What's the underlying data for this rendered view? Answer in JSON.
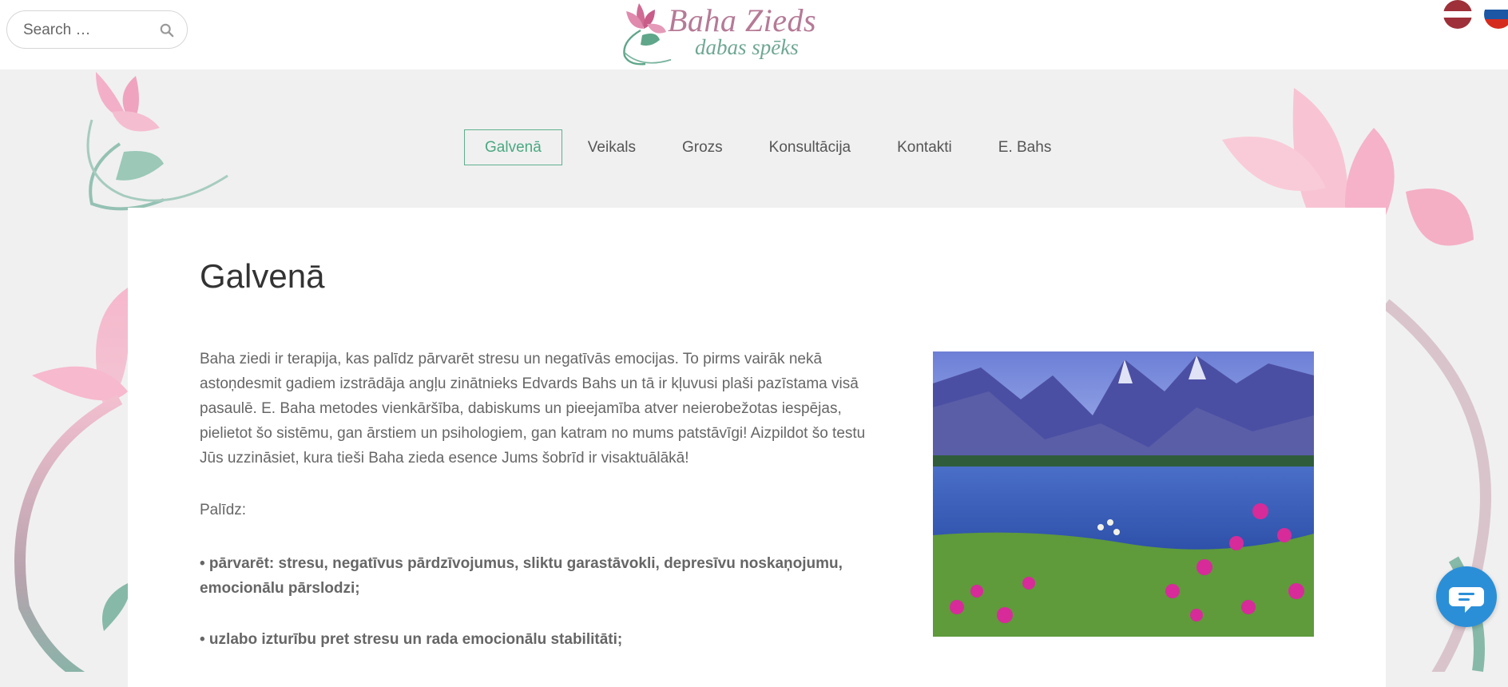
{
  "header": {
    "search": {
      "placeholder": "Search …"
    },
    "logo": {
      "title": "Baha Zieds",
      "subtitle": "dabas spēks"
    },
    "languages": [
      {
        "code": "lv",
        "colors": [
          "#9e3039",
          "#ffffff",
          "#9e3039"
        ]
      },
      {
        "code": "ru",
        "colors": [
          "#ffffff",
          "#1c57a5",
          "#d52b1e"
        ]
      }
    ]
  },
  "nav": {
    "items": [
      {
        "label": "Galvenā",
        "active": true
      },
      {
        "label": "Veikals"
      },
      {
        "label": "Grozs"
      },
      {
        "label": "Konsultācija"
      },
      {
        "label": "Kontakti"
      },
      {
        "label": "E. Bahs"
      }
    ]
  },
  "main": {
    "title": "Galvenā",
    "intro": "Baha ziedi ir terapija, kas palīdz pārvarēt stresu un negatīvās emocijas. To pirms vairāk nekā astoņdesmit gadiem izstrādāja angļu zinātnieks Edvards Bahs un tā ir kļuvusi plaši pazīstama visā pasaulē. E. Baha metodes vienkāršība, dabiskums un pieejamība atver neierobežotas iespējas, pielietot šo sistēmu, gan ārstiem un psihologiem, gan katram no mums patstāvīgi! Aizpildot šo testu Jūs uzzināsiet, kura tieši Baha zieda esence Jums šobrīd ir visaktuālākā!",
    "helps_label": "Palīdz:",
    "bullets": [
      "• pārvarēt: stresu, negatīvus pārdzīvojumus, sliktu garastāvokli, depresīvu noskaņojumu, emocionālu pārslodzi;",
      "• uzlabo izturību pret stresu un rada emocionālu stabilitāti;"
    ],
    "image_icon": "mountain-lake-flowers-photo"
  },
  "colors": {
    "accent": "#4aa882",
    "logo_pink": "#b57a96",
    "logo_green": "#6fa793",
    "chat_blue": "#2b8fd8"
  }
}
